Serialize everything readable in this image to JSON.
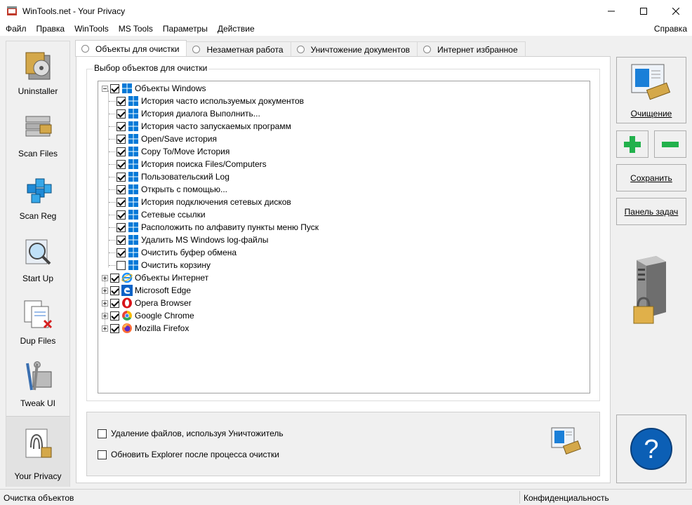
{
  "window": {
    "title": "WinTools.net - Your Privacy"
  },
  "menu": {
    "items": [
      "Файл",
      "Правка",
      "WinTools",
      "MS Tools",
      "Параметры",
      "Действие"
    ],
    "help": "Справка"
  },
  "sidebar": {
    "items": [
      {
        "label": "Uninstaller",
        "icon": "uninstaller-icon"
      },
      {
        "label": "Scan Files",
        "icon": "scan-files-icon"
      },
      {
        "label": "Scan Reg",
        "icon": "scan-reg-icon"
      },
      {
        "label": "Start Up",
        "icon": "start-up-icon"
      },
      {
        "label": "Dup Files",
        "icon": "dup-files-icon"
      },
      {
        "label": "Tweak UI",
        "icon": "tweak-ui-icon"
      },
      {
        "label": "Your Privacy",
        "icon": "your-privacy-icon",
        "active": true
      }
    ]
  },
  "tabs": [
    {
      "label": "Объекты для очистки",
      "active": true
    },
    {
      "label": "Незаметная работа"
    },
    {
      "label": "Уничтожение документов"
    },
    {
      "label": "Интернет избранное"
    }
  ],
  "group": {
    "legend": "Выбор объектов для очистки"
  },
  "tree": {
    "root": {
      "label": "Объекты Windows",
      "checked": true,
      "expanded": true,
      "icon": "windows-icon"
    },
    "children": [
      {
        "label": "История часто используемых документов",
        "checked": true
      },
      {
        "label": "История диалога Выполнить...",
        "checked": true
      },
      {
        "label": "История часто запускаемых программ",
        "checked": true
      },
      {
        "label": "Open/Save история",
        "checked": true
      },
      {
        "label": "Copy To/Move История",
        "checked": true
      },
      {
        "label": "История поиска Files/Computers",
        "checked": true
      },
      {
        "label": "Пользовательский Log",
        "checked": true
      },
      {
        "label": "Открыть с помощью...",
        "checked": true
      },
      {
        "label": "История подключения сетевых дисков",
        "checked": true
      },
      {
        "label": "Сетевые ссылки",
        "checked": true
      },
      {
        "label": "Расположить по алфавиту пункты меню Пуск",
        "checked": true
      },
      {
        "label": "Удалить MS Windows log-файлы",
        "checked": true
      },
      {
        "label": "Очистить буфер обмена",
        "checked": true
      },
      {
        "label": "Очистить корзину",
        "checked": false
      }
    ],
    "others": [
      {
        "label": "Объекты Интернет",
        "checked": true,
        "icon": "internet-explorer-icon"
      },
      {
        "label": "Microsoft Edge",
        "checked": true,
        "icon": "edge-icon"
      },
      {
        "label": "Opera Browser",
        "checked": true,
        "icon": "opera-icon"
      },
      {
        "label": "Google Chrome",
        "checked": true,
        "icon": "chrome-icon"
      },
      {
        "label": "Mozilla Firefox",
        "checked": true,
        "icon": "firefox-icon"
      }
    ]
  },
  "options": {
    "shred": {
      "label": "Удаление файлов, используя Уничтожитель",
      "checked": false
    },
    "explorer": {
      "label": "Обновить Explorer после процесса очистки",
      "checked": false
    }
  },
  "actions": {
    "clean": "Очищение",
    "save": "Сохранить",
    "taskbar": "Панель задач"
  },
  "status": {
    "left": "Очистка объектов",
    "right": "Конфиденциальность"
  },
  "colors": {
    "windows_blue": "#0078d7",
    "plus_green": "#22b14c",
    "help_blue": "#0c5fb5"
  }
}
